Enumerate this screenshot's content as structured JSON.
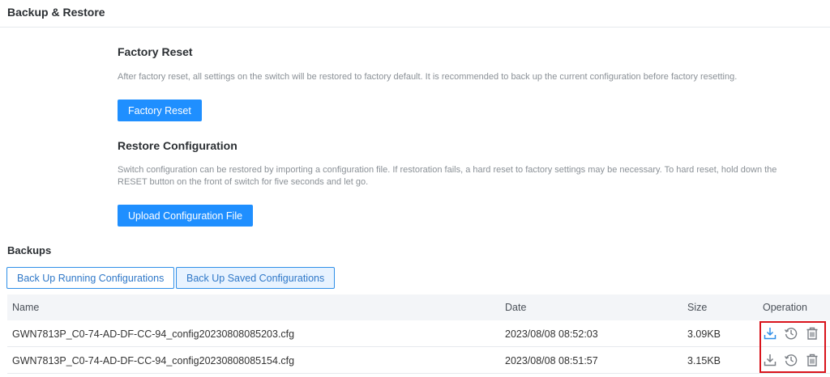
{
  "page": {
    "title": "Backup & Restore"
  },
  "factory_reset": {
    "title": "Factory Reset",
    "description": "After factory reset, all settings on the switch will be restored to factory default. It is recommended to back up the current configuration before factory resetting.",
    "button_label": "Factory Reset"
  },
  "restore": {
    "title": "Restore Configuration",
    "description_line1": "Switch configuration can be restored by importing a configuration file. If restoration fails, a hard reset to factory settings may be necessary. To hard reset, hold down the",
    "description_line2": "RESET button on the front of switch for five seconds and let go.",
    "button_label": "Upload Configuration File"
  },
  "backups": {
    "label": "Backups",
    "buttons": [
      {
        "label": "Back Up Running Configurations"
      },
      {
        "label": "Back Up Saved Configurations",
        "active": true
      }
    ],
    "columns": {
      "name": "Name",
      "date": "Date",
      "size": "Size",
      "operation": "Operation"
    },
    "rows": [
      {
        "name": "GWN7813P_C0-74-AD-DF-CC-94_config20230808085203.cfg",
        "date": "2023/08/08 08:52:03",
        "size": "3.09KB",
        "operations": [
          "download-icon",
          "restore-history-icon",
          "delete-trash-icon"
        ]
      },
      {
        "name": "GWN7813P_C0-74-AD-DF-CC-94_config20230808085154.cfg",
        "date": "2023/08/08 08:51:57",
        "size": "3.15KB",
        "operations": [
          "download-icon",
          "restore-history-icon",
          "delete-trash-icon"
        ]
      }
    ]
  },
  "colors": {
    "primary": "#1f8fff",
    "highlight": "#d9141c",
    "header_bg": "#f3f5f8"
  }
}
